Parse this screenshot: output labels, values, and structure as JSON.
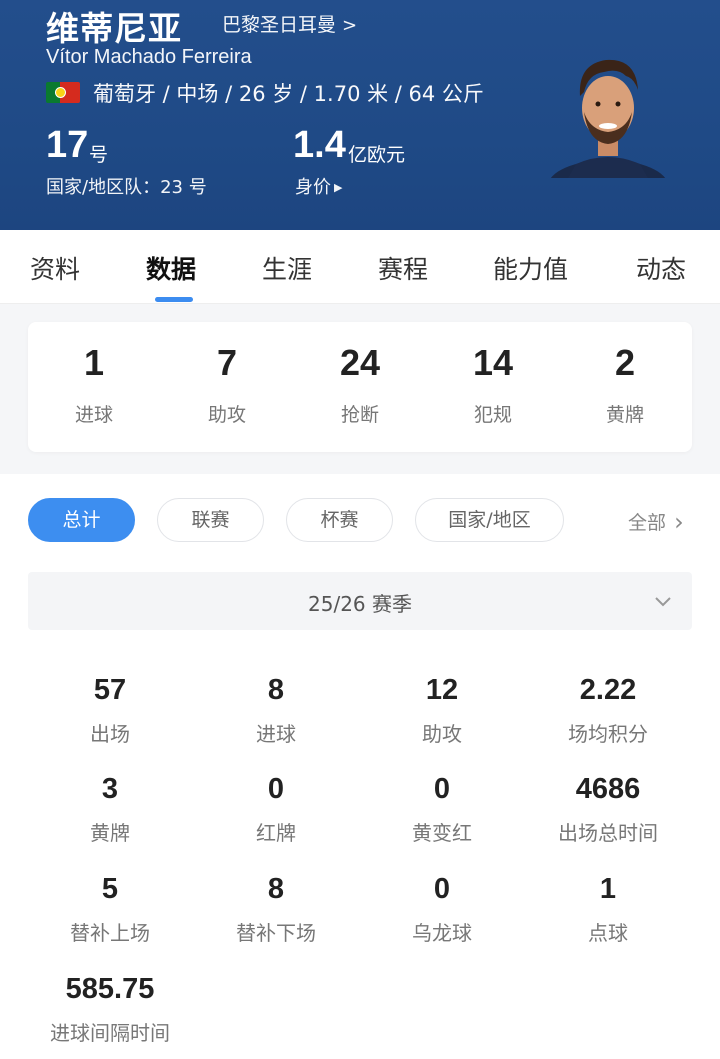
{
  "player": {
    "name": "维蒂尼亚",
    "club": "巴黎圣日耳曼",
    "club_chevron": ">",
    "full_name": "Vítor Machado Ferreira",
    "info": "葡萄牙 / 中场 / 26 岁 / 1.70 米 / 64 公斤",
    "number": "17",
    "number_unit": "号",
    "national_team": "国家/地区队：23 号",
    "market_value": "1.4",
    "market_value_unit": "亿欧元",
    "market_value_label": "身价",
    "market_value_label_arrow": "▶",
    "flag_colors": {
      "green": "#0a7a2f",
      "red": "#d52b1e",
      "emblem": "#f7d417"
    }
  },
  "tabs": [
    "资料",
    "数据",
    "生涯",
    "赛程",
    "能力值",
    "动态"
  ],
  "active_tab": "数据",
  "summary": [
    {
      "value": "1",
      "label": "进球"
    },
    {
      "value": "7",
      "label": "助攻"
    },
    {
      "value": "24",
      "label": "抢断"
    },
    {
      "value": "14",
      "label": "犯规"
    },
    {
      "value": "2",
      "label": "黄牌"
    }
  ],
  "filters": [
    "总计",
    "联赛",
    "杯赛",
    "国家/地区"
  ],
  "active_filter": "总计",
  "filter_all": "全部",
  "filter_all_chevron": "›",
  "season": "25/26 赛季",
  "stats": [
    {
      "value": "57",
      "label": "出场"
    },
    {
      "value": "8",
      "label": "进球"
    },
    {
      "value": "12",
      "label": "助攻"
    },
    {
      "value": "2.22",
      "label": "场均积分"
    },
    {
      "value": "3",
      "label": "黄牌"
    },
    {
      "value": "0",
      "label": "红牌"
    },
    {
      "value": "0",
      "label": "黄变红"
    },
    {
      "value": "4686",
      "label": "出场总时间"
    },
    {
      "value": "5",
      "label": "替补上场"
    },
    {
      "value": "8",
      "label": "替补下场"
    },
    {
      "value": "0",
      "label": "乌龙球"
    },
    {
      "value": "1",
      "label": "点球"
    },
    {
      "value": "585.75",
      "label": "进球间隔时间"
    }
  ],
  "colors": {
    "header_bg": "#1f4a86",
    "accent": "#3d8ef0",
    "muted_text": "#777777"
  }
}
